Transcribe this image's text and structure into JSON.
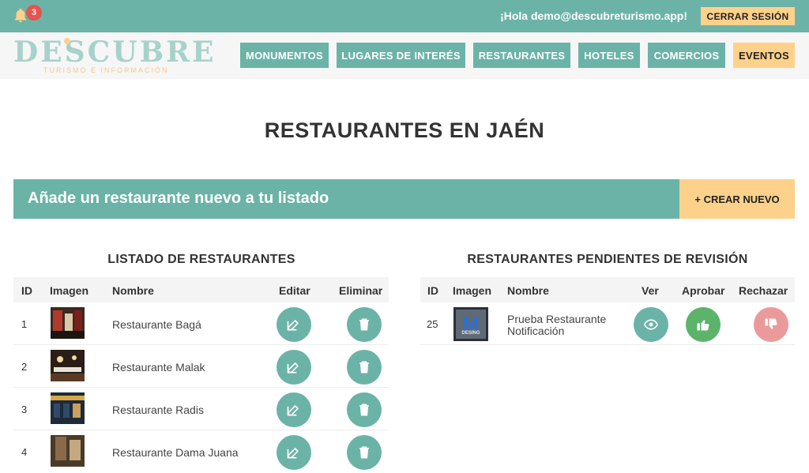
{
  "topbar": {
    "notification_count": "3",
    "greeting": "¡Hola demo@descubreturismo.app!",
    "logout_label": "CERRAR SESIÓN"
  },
  "logo": {
    "word": "DESCUBRE",
    "tagline": "TURISMO E INFORMACIÓN"
  },
  "nav": [
    {
      "label": "MONUMENTOS"
    },
    {
      "label": "LUGARES DE INTERÉS"
    },
    {
      "label": "RESTAURANTES"
    },
    {
      "label": "HOTELES"
    },
    {
      "label": "COMERCIOS"
    },
    {
      "label": "EVENTOS"
    }
  ],
  "page_title": "RESTAURANTES EN JAÉN",
  "banner": {
    "text": "Añade un restaurante nuevo a tu listado",
    "create_label": "+ CREAR NUEVO"
  },
  "listado": {
    "title": "LISTADO DE RESTAURANTES",
    "headers": {
      "id": "ID",
      "image": "Imagen",
      "name": "Nombre",
      "edit": "Editar",
      "delete": "Eliminar"
    },
    "rows": [
      {
        "id": "1",
        "name": "Restaurante Bagá"
      },
      {
        "id": "2",
        "name": "Restaurante Malak"
      },
      {
        "id": "3",
        "name": "Restaurante Radis"
      },
      {
        "id": "4",
        "name": "Restaurante Dama Juana"
      }
    ]
  },
  "pendientes": {
    "title": "RESTAURANTES PENDIENTES DE REVISIÓN",
    "headers": {
      "id": "ID",
      "image": "Imagen",
      "name": "Nombre",
      "view": "Ver",
      "approve": "Aprobar",
      "reject": "Rechazar"
    },
    "rows": [
      {
        "id": "25",
        "name_line1": "Prueba Restaurante",
        "name_line2": "Notificación",
        "thumb_text": "DESING"
      }
    ]
  },
  "colors": {
    "primary": "#6bb3a7",
    "accent": "#fed18b",
    "approve": "#5cb36a",
    "reject": "#eb9a9b",
    "badge": "#e8524f"
  },
  "icons": {
    "notifications": "bell-icon",
    "edit": "edit-icon",
    "delete": "trash-icon",
    "view": "eye-icon",
    "approve": "thumbs-up-icon",
    "reject": "thumbs-down-icon"
  }
}
